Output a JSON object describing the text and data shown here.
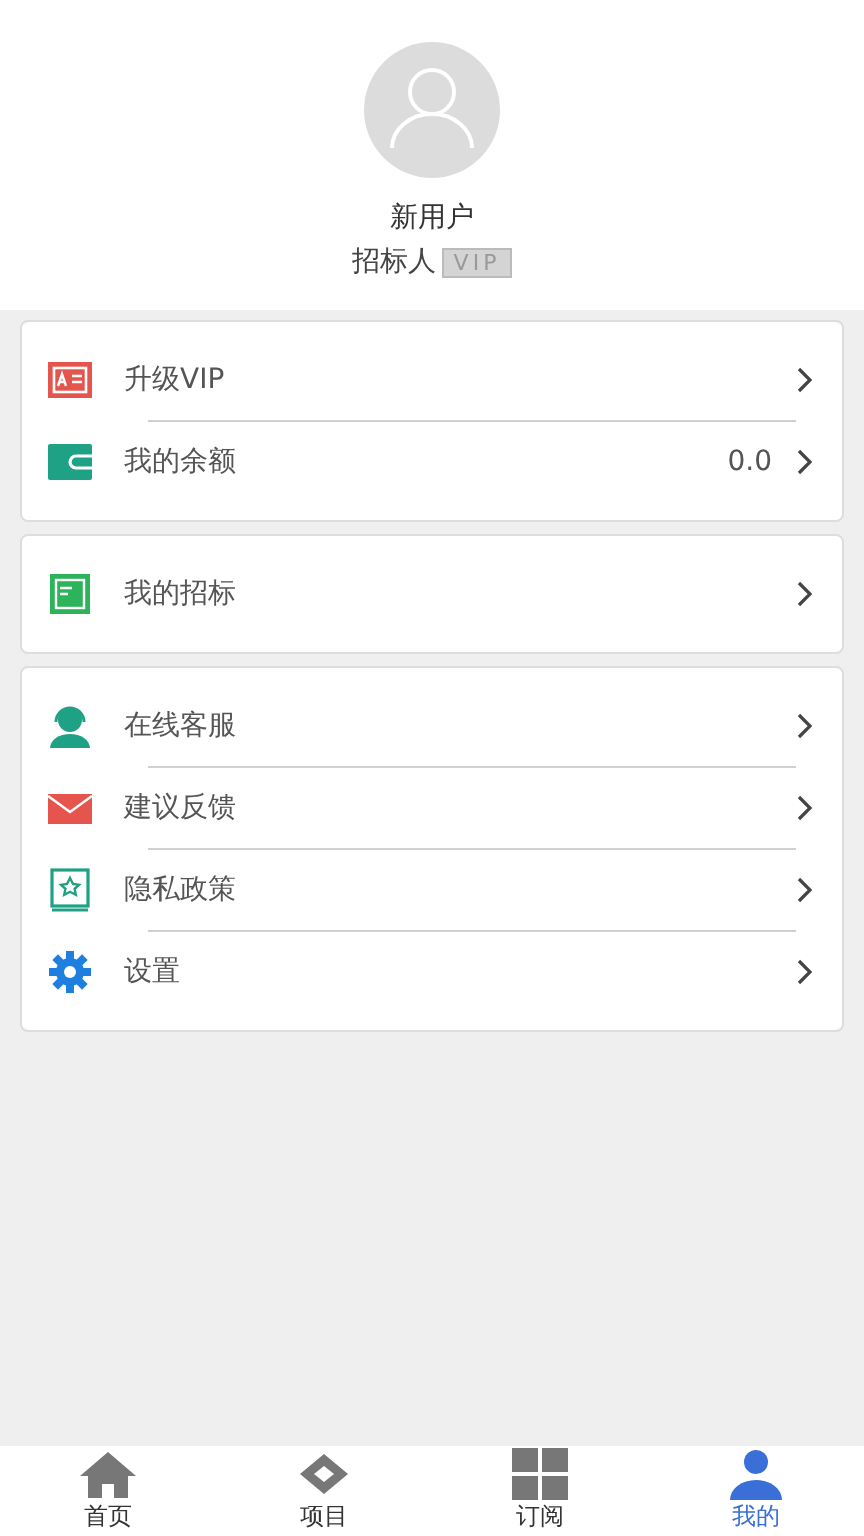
{
  "profile": {
    "name": "新用户",
    "role": "招标人",
    "badge": "VIP"
  },
  "groups": [
    {
      "items": [
        {
          "kind": "vip",
          "label": "升级VIP"
        },
        {
          "kind": "wallet",
          "label": "我的余额",
          "value": "0.0"
        }
      ]
    },
    {
      "items": [
        {
          "kind": "notebook",
          "label": "我的招标"
        }
      ]
    },
    {
      "items": [
        {
          "kind": "support",
          "label": "在线客服"
        },
        {
          "kind": "mail",
          "label": "建议反馈"
        },
        {
          "kind": "privacy",
          "label": "隐私政策"
        },
        {
          "kind": "settings",
          "label": "设置"
        }
      ]
    }
  ],
  "tabs": [
    {
      "kind": "home",
      "label": "首页",
      "selected": false
    },
    {
      "kind": "project",
      "label": "项目",
      "selected": false
    },
    {
      "kind": "grid",
      "label": "订阅",
      "selected": false
    },
    {
      "kind": "me",
      "label": "我的",
      "selected": true
    }
  ]
}
